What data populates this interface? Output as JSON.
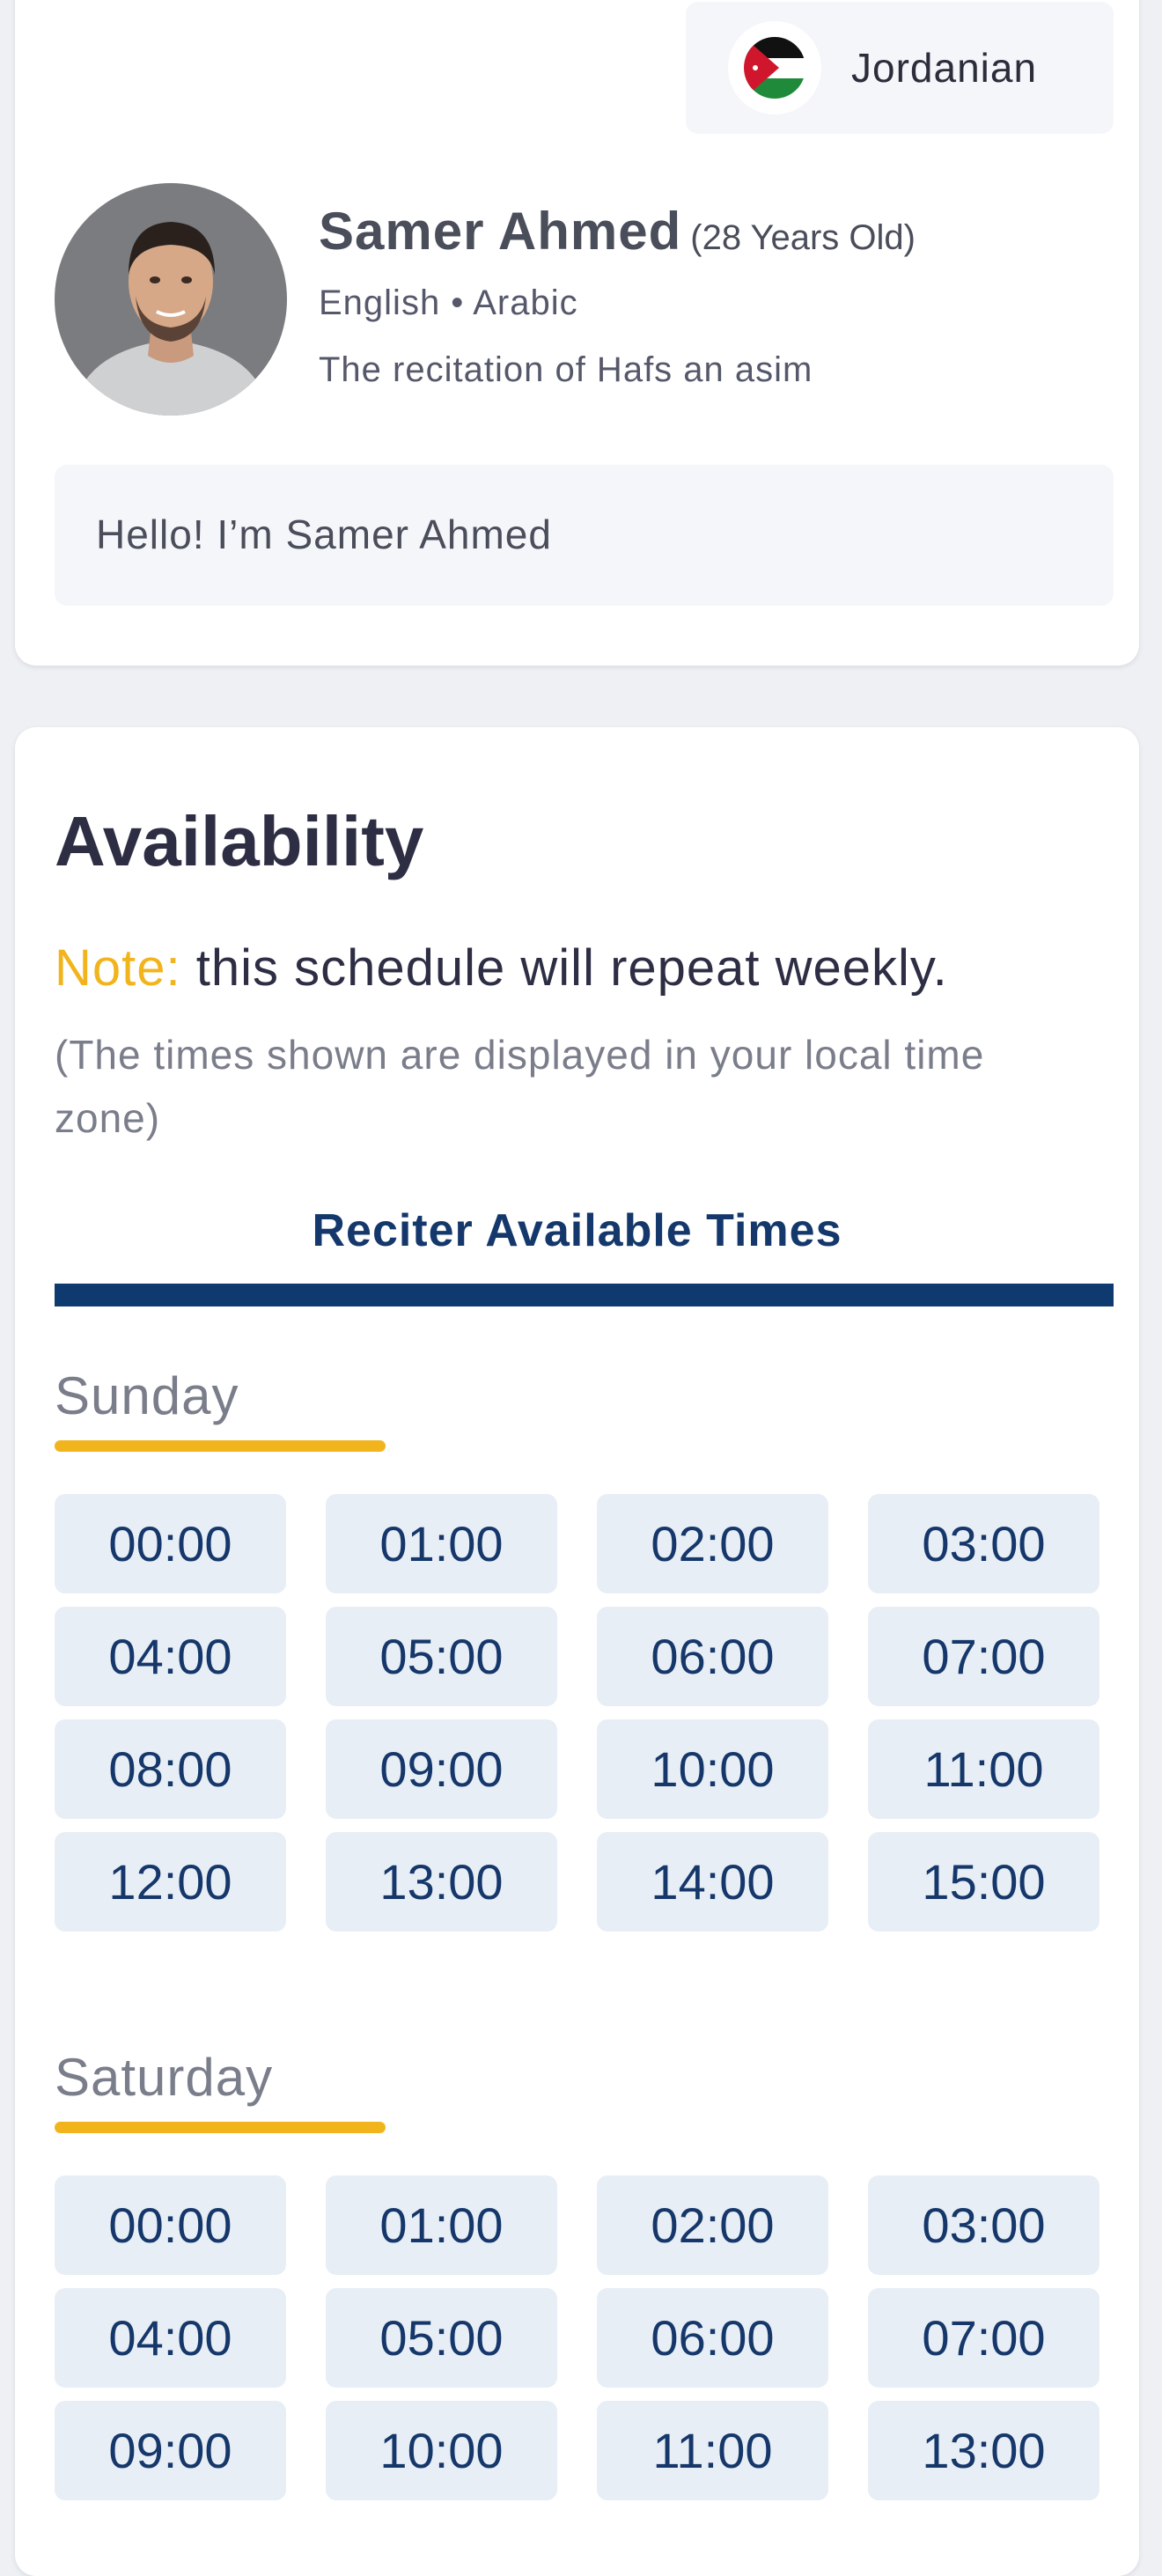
{
  "profile": {
    "nationality": "Jordanian",
    "flag_icon": "jordan-flag-icon",
    "name": "Samer Ahmed",
    "age_text": "(28 Years Old)",
    "languages": "English • Arabic",
    "recitation": "The recitation of Hafs an asim",
    "bio": "Hello! I’m Samer Ahmed"
  },
  "availability": {
    "title": "Availability",
    "note_prefix": "Note:",
    "note_text": " this schedule will repeat weekly.",
    "timezone_note": "(The times shown are displayed in your local time zone)",
    "tab_label": "Reciter Available Times",
    "days": [
      {
        "name": "Sunday",
        "slots": [
          "00:00",
          "01:00",
          "02:00",
          "03:00",
          "04:00",
          "05:00",
          "06:00",
          "07:00",
          "08:00",
          "09:00",
          "10:00",
          "11:00",
          "12:00",
          "13:00",
          "14:00",
          "15:00"
        ]
      },
      {
        "name": "Saturday",
        "slots": [
          "00:00",
          "01:00",
          "02:00",
          "03:00",
          "04:00",
          "05:00",
          "06:00",
          "07:00",
          "09:00",
          "10:00",
          "11:00",
          "13:00"
        ]
      }
    ]
  },
  "colors": {
    "accent_yellow": "#f2b41c",
    "primary_navy": "#0f3a70",
    "slot_bg": "#e8eef6",
    "slot_text": "#15376a"
  }
}
